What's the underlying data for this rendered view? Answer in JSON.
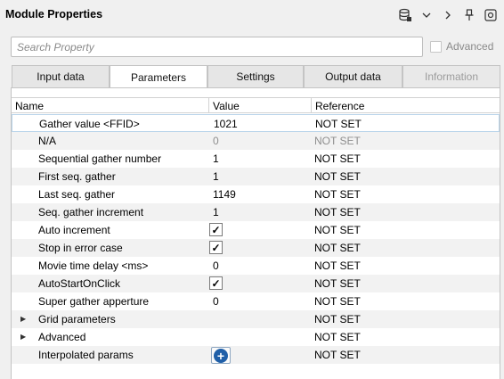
{
  "header": {
    "title": "Module Properties",
    "icons": [
      "database-icon",
      "chevron-down-icon",
      "chevron-right-icon",
      "pin-icon",
      "gear-icon"
    ]
  },
  "search": {
    "placeholder": "Search Property",
    "advanced_label": "Advanced",
    "advanced_checked": false
  },
  "tabs": [
    {
      "label": "Input data",
      "active": false,
      "enabled": true
    },
    {
      "label": "Parameters",
      "active": true,
      "enabled": true
    },
    {
      "label": "Settings",
      "active": false,
      "enabled": true
    },
    {
      "label": "Output data",
      "active": false,
      "enabled": true
    },
    {
      "label": "Information",
      "active": false,
      "enabled": false
    }
  ],
  "table": {
    "columns": [
      "Name",
      "Value",
      "Reference"
    ],
    "rows": [
      {
        "name": "Gather value <FFID>",
        "value": "1021",
        "reference": "NOT SET"
      },
      {
        "name": "N/A",
        "value": "0",
        "reference": "NOT SET"
      },
      {
        "name": "Sequential gather number",
        "value": "1",
        "reference": "NOT SET"
      },
      {
        "name": "First seq. gather",
        "value": "1",
        "reference": "NOT SET"
      },
      {
        "name": "Last seq. gather",
        "value": "1149",
        "reference": "NOT SET"
      },
      {
        "name": "Seq. gather increment",
        "value": "1",
        "reference": "NOT SET"
      },
      {
        "name": "Auto increment",
        "value": "✓",
        "reference": "NOT SET"
      },
      {
        "name": "Stop in error case",
        "value": "✓",
        "reference": "NOT SET"
      },
      {
        "name": "Movie time delay <ms>",
        "value": "0",
        "reference": "NOT SET"
      },
      {
        "name": "AutoStartOnClick",
        "value": "✓",
        "reference": "NOT SET"
      },
      {
        "name": "Super gather apperture",
        "value": "0",
        "reference": "NOT SET"
      },
      {
        "name": "Grid parameters",
        "value": "",
        "reference": "NOT SET"
      },
      {
        "name": "Advanced",
        "value": "",
        "reference": "NOT SET"
      },
      {
        "name": "Interpolated params",
        "value": "+",
        "reference": "NOT SET"
      }
    ]
  },
  "colors": {
    "background": "#f0f0f0",
    "selected_row_border": "#b9d4ea",
    "add_button": "#1f5fa8",
    "disabled_text": "#8e8e8e"
  }
}
